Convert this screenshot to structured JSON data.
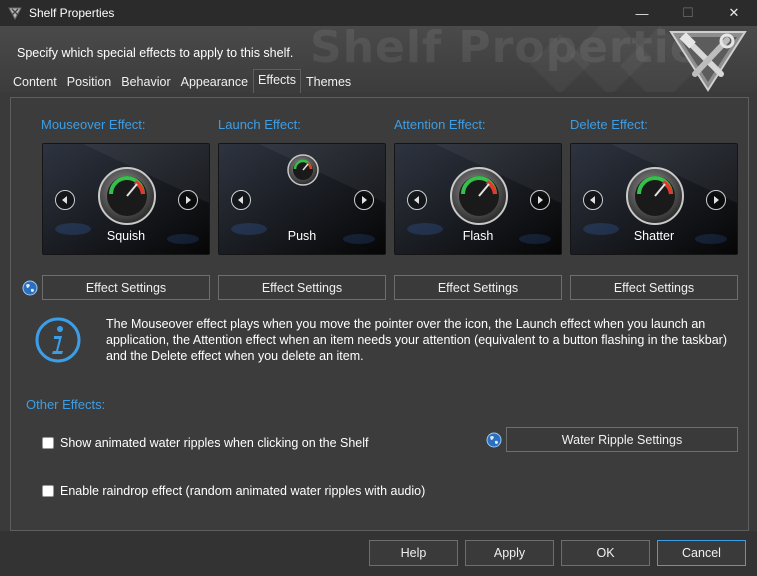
{
  "window": {
    "title": "Shelf Properties",
    "minimize_glyph": "—",
    "maximize_glyph": "☐",
    "close_glyph": "✕"
  },
  "header": {
    "subtitle": "Specify which special effects to apply to this shelf.",
    "watermark": "Shelf Properties"
  },
  "tabs": [
    {
      "label": "Content"
    },
    {
      "label": "Position"
    },
    {
      "label": "Behavior"
    },
    {
      "label": "Appearance"
    },
    {
      "label": "Effects",
      "active": true
    },
    {
      "label": "Themes"
    }
  ],
  "effects": [
    {
      "label": "Mouseover Effect:",
      "name": "Squish",
      "settings": "Effect Settings"
    },
    {
      "label": "Launch Effect:",
      "name": "Push",
      "settings": "Effect Settings"
    },
    {
      "label": "Attention Effect:",
      "name": "Flash",
      "settings": "Effect Settings"
    },
    {
      "label": "Delete Effect:",
      "name": "Shatter",
      "settings": "Effect Settings"
    }
  ],
  "info": {
    "text": "The Mouseover effect plays when you move the pointer over the icon, the Launch effect when you launch an application, the Attention effect when an item needs your attention (equivalent to a button flashing in the taskbar) and the Delete effect when you delete an item."
  },
  "other": {
    "label": "Other Effects:",
    "ripples": {
      "label": "Show animated water ripples when clicking on the Shelf",
      "checked": false
    },
    "ripple_settings": "Water Ripple Settings",
    "raindrop": {
      "label": "Enable raindrop effect (random animated water ripples with audio)",
      "checked": false
    }
  },
  "footer": {
    "help": "Help",
    "apply": "Apply",
    "ok": "OK",
    "cancel": "Cancel"
  },
  "colors": {
    "accent": "#3c9ee6",
    "background": "#3c3c3c",
    "titlebar": "#2b2b2b"
  }
}
